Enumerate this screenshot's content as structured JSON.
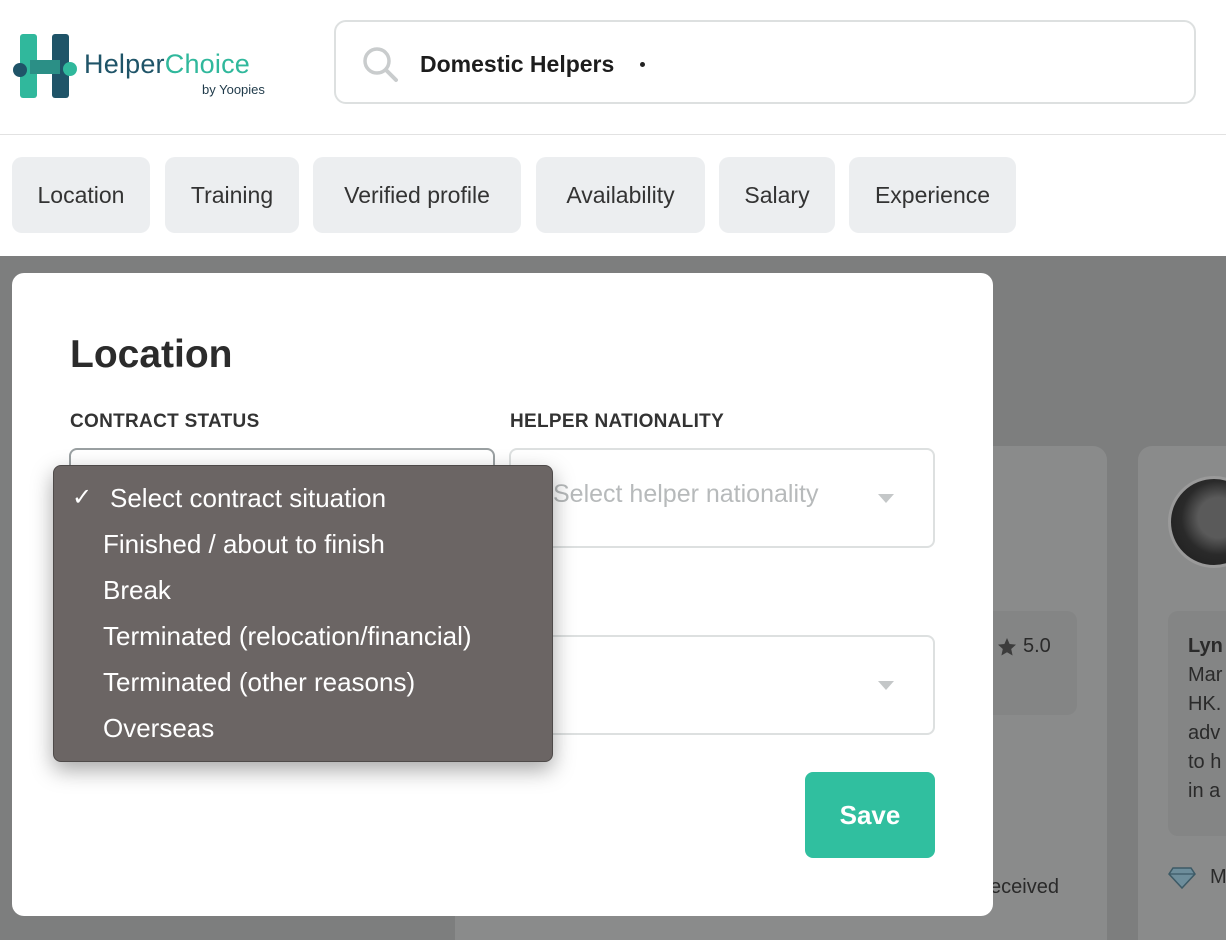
{
  "brand": {
    "name_part1": "Helper",
    "name_part2": "Choice",
    "tagline": "by Yoopies",
    "colors": {
      "teal": "#30b89c",
      "navy": "#1f5468"
    }
  },
  "search": {
    "icon": "search-icon",
    "value": "Domestic Helpers"
  },
  "filters": [
    "Location",
    "Training",
    "Verified profile",
    "Availability",
    "Salary",
    "Experience"
  ],
  "modal": {
    "title": "Location",
    "contract_status": {
      "label": "CONTRACT STATUS",
      "options": [
        {
          "label": "Select contract situation",
          "selected": true
        },
        {
          "label": "Finished / about to finish",
          "selected": false
        },
        {
          "label": "Break",
          "selected": false
        },
        {
          "label": "Terminated (relocation/financial)",
          "selected": false
        },
        {
          "label": "Terminated (other reasons)",
          "selected": false
        },
        {
          "label": "Overseas",
          "selected": false
        }
      ]
    },
    "helper_nationality": {
      "label": "HELPER NATIONALITY",
      "placeholder": "Select helper nationality"
    },
    "save_label": "Save",
    "accent_color": "#30bf9f"
  },
  "background": {
    "rating": "5.0",
    "received_fragment": "eceived",
    "profile_text": [
      "Lyn",
      "Mar",
      "HK.",
      "adv",
      "to h",
      "in a",
      "M"
    ]
  }
}
